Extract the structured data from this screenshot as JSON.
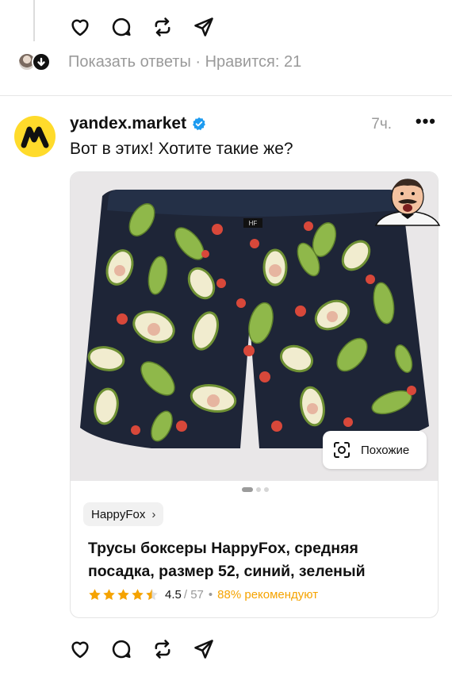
{
  "top_actions": {
    "icons": [
      "heart-icon",
      "comment-icon",
      "repost-icon",
      "share-icon"
    ]
  },
  "replies": {
    "label": "Показать ответы · Нравится: 21"
  },
  "post": {
    "username": "yandex.market",
    "time": "7ч.",
    "text": "Вот в этих! Хотите такие же?",
    "more_label": "•••"
  },
  "card": {
    "similar_label": "Похожие",
    "brand": "HappyFox",
    "brand_chevron": "›",
    "title": "Трусы боксеры HappyFox, средняя посадка, размер 52, синий, зеленый",
    "rating": "4.5",
    "rating_count": "/ 57",
    "rating_sep": "•",
    "recommend": "88% рекомендуют",
    "stars_value": 4.5,
    "image_index": {
      "current": 1,
      "total": 3
    },
    "waistband_tag": "HF"
  },
  "colors": {
    "star": "#f5a300",
    "verified": "#1d9bf0",
    "yandex_yellow": "#ffdb2b",
    "shorts_navy": "#1e2537"
  },
  "bottom_actions": {
    "icons": [
      "heart-icon",
      "comment-icon",
      "repost-icon",
      "share-icon"
    ]
  }
}
